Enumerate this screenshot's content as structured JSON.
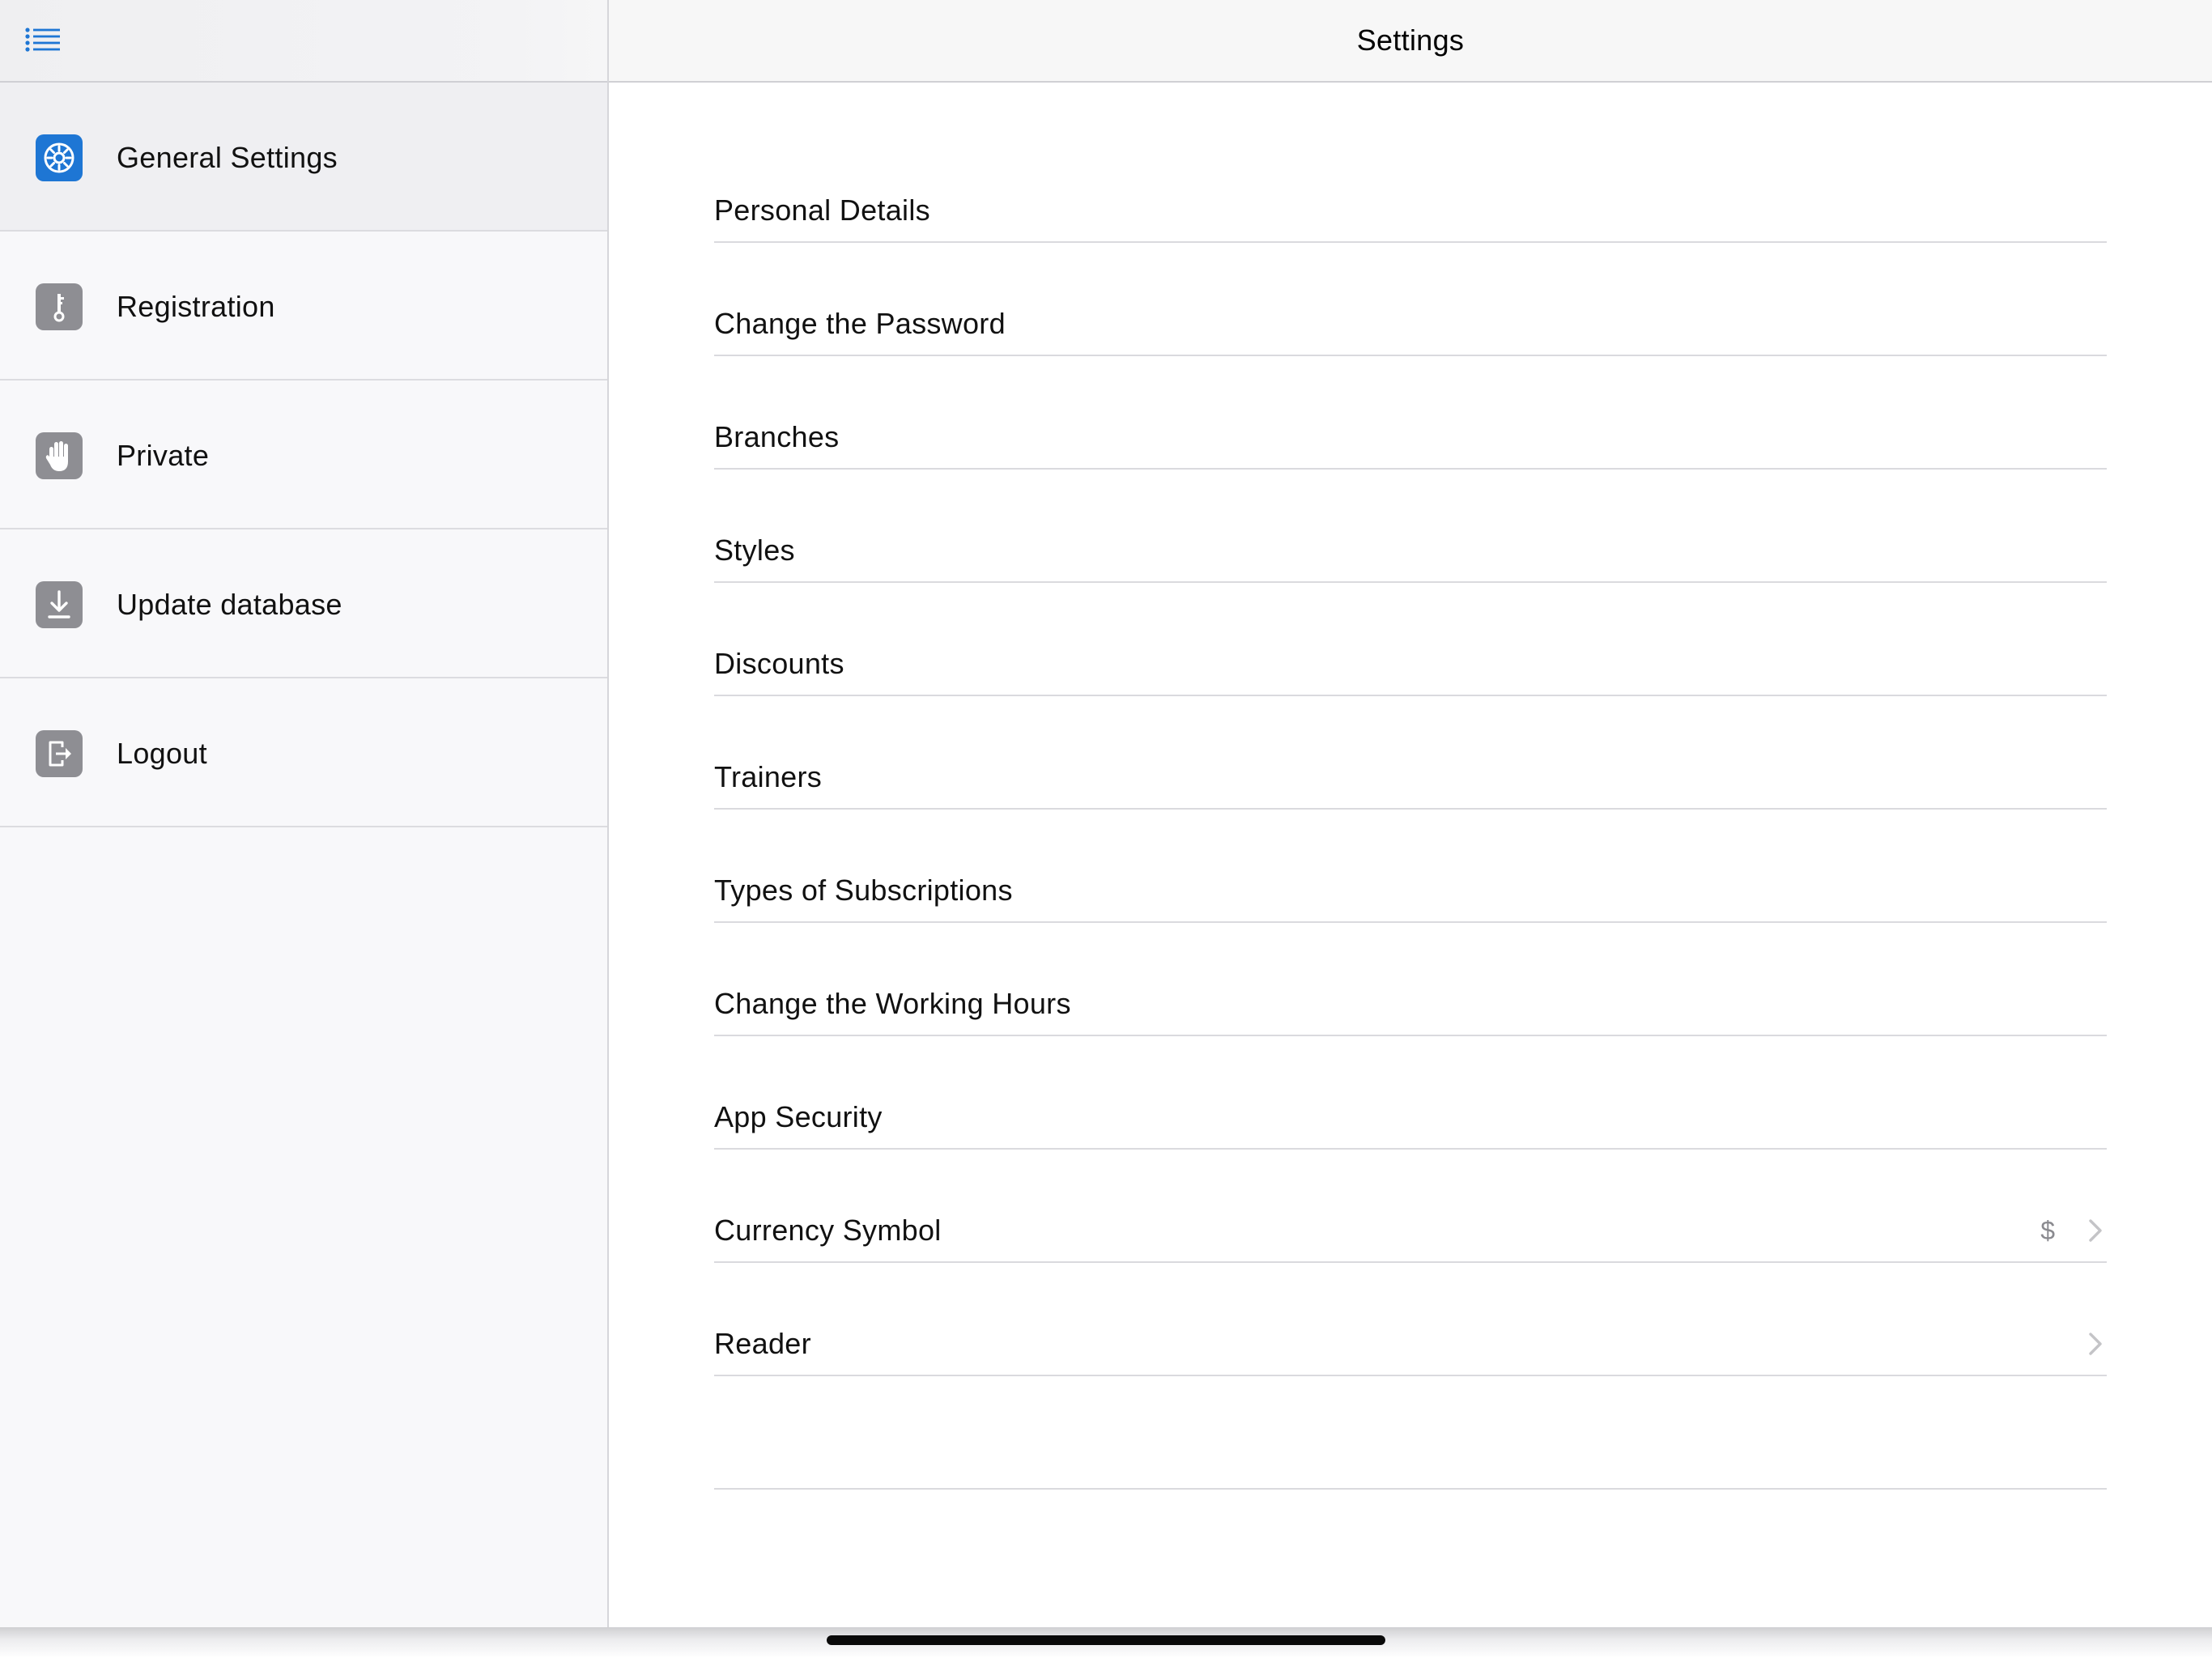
{
  "colors": {
    "accent": "#1e76d4",
    "icon_inactive": "#8e8e93",
    "separator": "#dadade",
    "sidebar_bg": "#f8f8fa",
    "sidebar_active_bg": "#efeff2"
  },
  "sidebar": {
    "menu_icon": "list-icon",
    "items": [
      {
        "label": "General Settings",
        "icon": "gear-icon",
        "active": true
      },
      {
        "label": "Registration",
        "icon": "key-icon",
        "active": false
      },
      {
        "label": "Private",
        "icon": "hand-icon",
        "active": false
      },
      {
        "label": "Update database",
        "icon": "download-icon",
        "active": false
      },
      {
        "label": "Logout",
        "icon": "logout-icon",
        "active": false
      }
    ]
  },
  "main": {
    "title": "Settings",
    "rows": [
      {
        "label": "Personal Details"
      },
      {
        "label": "Change the Password"
      },
      {
        "label": "Branches"
      },
      {
        "label": "Styles"
      },
      {
        "label": "Discounts"
      },
      {
        "label": "Trainers"
      },
      {
        "label": "Types of Subscriptions"
      },
      {
        "label": "Change the Working Hours"
      },
      {
        "label": "App Security"
      },
      {
        "label": "Currency Symbol",
        "value": "$",
        "chevron": true
      },
      {
        "label": "Reader",
        "chevron": true
      }
    ]
  }
}
